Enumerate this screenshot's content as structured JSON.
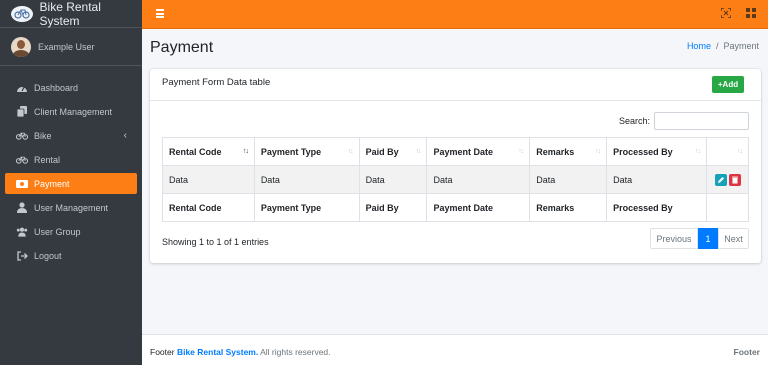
{
  "brand": {
    "name": "Bike Rental System",
    "logo_icon": "bike-logo-icon"
  },
  "user": {
    "name": "Example User"
  },
  "sidebar": {
    "items": [
      {
        "label": "Dashboard",
        "icon": "tachometer-icon"
      },
      {
        "label": "Client Management",
        "icon": "copy-icon"
      },
      {
        "label": "Bike",
        "icon": "bicycle-icon",
        "chevron": "‹"
      },
      {
        "label": "Rental",
        "icon": "bicycle-icon"
      },
      {
        "label": "Payment",
        "icon": "money-icon",
        "active": true
      },
      {
        "label": "User Management",
        "icon": "user-icon"
      },
      {
        "label": "User Group",
        "icon": "users-icon"
      },
      {
        "label": "Logout",
        "icon": "sign-out-icon"
      }
    ]
  },
  "header": {
    "title": "Payment",
    "breadcrumb_home": "Home",
    "breadcrumb_sep": "/",
    "breadcrumb_current": "Payment"
  },
  "card": {
    "title": "Payment Form Data table",
    "add_label": "+Add"
  },
  "search": {
    "label": "Search:",
    "value": ""
  },
  "table": {
    "columns": [
      "Rental Code",
      "Payment Type",
      "Paid By",
      "Payment Date",
      "Remarks",
      "Processed By",
      ""
    ],
    "rows": [
      [
        "Data",
        "Data",
        "Data",
        "Data",
        "Data",
        "Data"
      ]
    ],
    "footer_columns": [
      "Rental Code",
      "Payment Type",
      "Paid By",
      "Payment Date",
      "Remarks",
      "Processed By",
      ""
    ]
  },
  "pagination": {
    "info": "Showing 1 to 1 of 1 entries",
    "previous": "Previous",
    "current": "1",
    "next": "Next"
  },
  "footer": {
    "prefix": "Footer",
    "brand": "Bike Rental System.",
    "suffix": "All rights reserved.",
    "right": "Footer"
  },
  "colors": {
    "accent": "#fd7e14",
    "sidebar": "#343a40",
    "primary": "#007bff",
    "success": "#28a745",
    "info": "#17a2b8",
    "danger": "#dc3545"
  }
}
